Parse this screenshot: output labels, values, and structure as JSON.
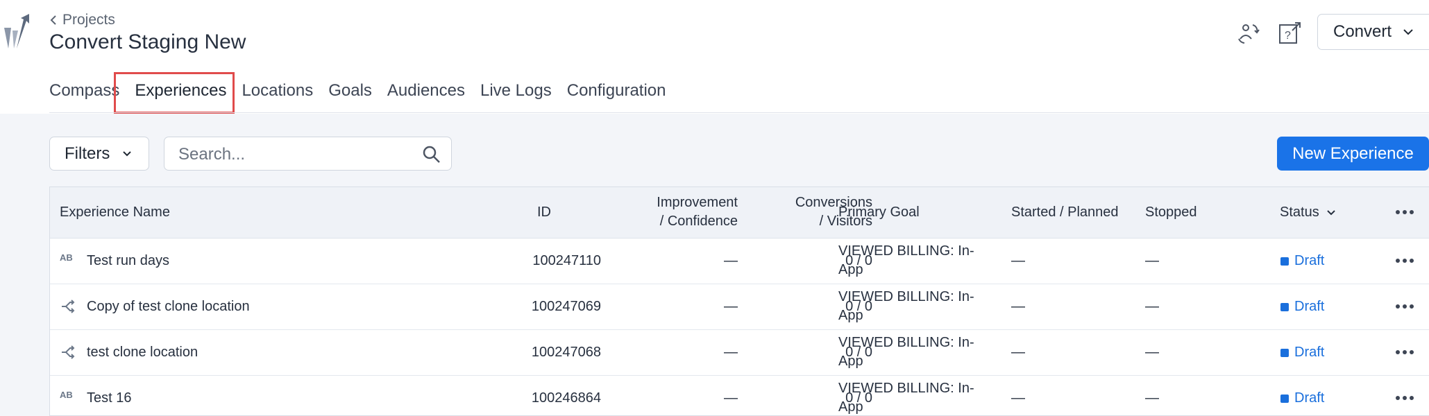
{
  "header": {
    "breadcrumb": "Projects",
    "title": "Convert Staging New",
    "account_button": "Convert"
  },
  "tabs": [
    {
      "label": "Compass",
      "active": false
    },
    {
      "label": "Experiences",
      "active": true
    },
    {
      "label": "Locations",
      "active": false
    },
    {
      "label": "Goals",
      "active": false
    },
    {
      "label": "Audiences",
      "active": false
    },
    {
      "label": "Live Logs",
      "active": false
    },
    {
      "label": "Configuration",
      "active": false
    }
  ],
  "toolbar": {
    "filters_label": "Filters",
    "search_placeholder": "Search...",
    "new_button": "New Experience"
  },
  "table": {
    "columns": {
      "name": "Experience Name",
      "id": "ID",
      "improvement_1": "Improvement",
      "improvement_2": "/ Confidence",
      "conversions_1": "Conversions",
      "conversions_2": "/ Visitors",
      "goal": "Primary Goal",
      "started": "Started / Planned",
      "stopped": "Stopped",
      "status": "Status"
    },
    "rows": [
      {
        "type_icon": "ab-test-icon",
        "name": "Test run days",
        "id": "100247110",
        "improvement": "—",
        "conversions": "0 / 0",
        "goal_1": "VIEWED BILLING: In-",
        "goal_2": "App",
        "started": "—",
        "stopped": "—",
        "status": "Draft"
      },
      {
        "type_icon": "split-url-icon",
        "name": "Copy of test clone location",
        "id": "100247069",
        "improvement": "—",
        "conversions": "0 / 0",
        "goal_1": "VIEWED BILLING: In-",
        "goal_2": "App",
        "started": "—",
        "stopped": "—",
        "status": "Draft"
      },
      {
        "type_icon": "split-url-icon",
        "name": "test clone location",
        "id": "100247068",
        "improvement": "—",
        "conversions": "0 / 0",
        "goal_1": "VIEWED BILLING: In-",
        "goal_2": "App",
        "started": "—",
        "stopped": "—",
        "status": "Draft"
      },
      {
        "type_icon": "ab-test-icon",
        "name": "Test 16",
        "id": "100246864",
        "improvement": "—",
        "conversions": "0 / 0",
        "goal_1": "VIEWED BILLING: In-",
        "goal_2": "App",
        "started": "—",
        "stopped": "—",
        "status": "Draft"
      }
    ]
  },
  "icons": {
    "ab": "AB"
  },
  "colors": {
    "accent": "#1a73e8",
    "highlight": "#e04b4b",
    "status_draft": "#1a6fdc"
  }
}
